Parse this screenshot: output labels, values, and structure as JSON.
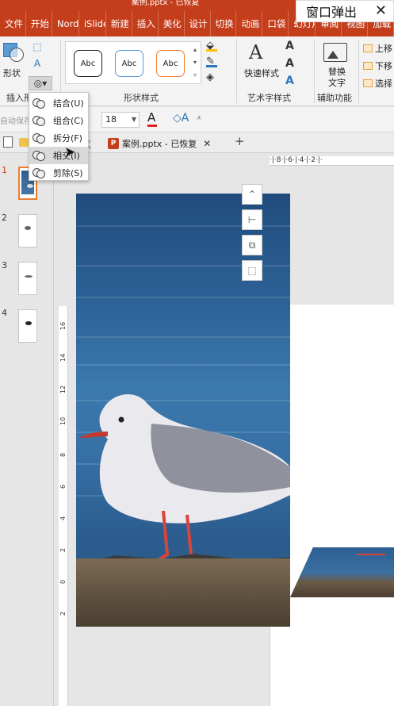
{
  "window": {
    "title": "案例.pptx - 已恢复"
  },
  "popup": {
    "label": "窗口弹出",
    "close": "✕"
  },
  "ribbon_tabs": [
    "文件",
    "开始",
    "Nord",
    "iSlide",
    "新建",
    "插入",
    "美化",
    "设计",
    "切换",
    "动画",
    "口袋",
    "幻灯片",
    "审阅",
    "视图",
    "加载"
  ],
  "ribbon": {
    "shape_label": "形状",
    "insert_shape_group": "插入形",
    "shape_style_group": "形状样式",
    "style_preview": "Abc",
    "wordart_label": "快速样式",
    "wordart_group": "艺术字样式",
    "alt_text_label": "替换文字",
    "accessibility_group": "辅助功能",
    "arrange_items": [
      "上移",
      "下移",
      "选择"
    ]
  },
  "fontbar": {
    "autosave": "自动保存",
    "font_size": "18"
  },
  "merge_menu": {
    "items": [
      {
        "label": "结合(U)"
      },
      {
        "label": "组合(C)"
      },
      {
        "label": "拆分(F)"
      },
      {
        "label": "相交(I)"
      },
      {
        "label": "剪除(S)"
      }
    ]
  },
  "doc_tabs": {
    "prev_tab_fragment": "区",
    "active": "案例.pptx - 已恢复",
    "close": "✕",
    "new": "+",
    "pptx_badge": "P"
  },
  "slides": [
    "1",
    "2",
    "3",
    "4"
  ],
  "hruler_text": "·|·8·|·6·|·4·|·2·|·",
  "vruler_ticks": [
    "16",
    "14",
    "12",
    "10",
    "8",
    "6",
    "4",
    "2",
    "0",
    "2"
  ],
  "float_tools": [
    "⌃",
    "⊢",
    "⧉",
    "⬚"
  ],
  "colors": {
    "accent": "#c43e1c",
    "selected_thumb": "#ed7d31",
    "hover": "#d9d9d9"
  }
}
